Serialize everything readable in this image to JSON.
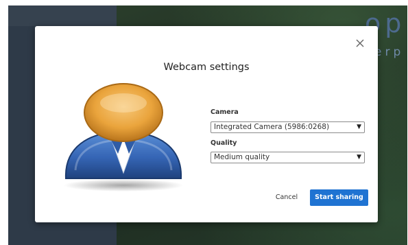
{
  "background": {
    "logo_text": "op",
    "tagline_text": "erp"
  },
  "dialog": {
    "title": "Webcam settings",
    "close_icon": "close-icon",
    "avatar_icon": "user-avatar-icon",
    "camera": {
      "label": "Camera",
      "selected": "Integrated Camera (5986:0268)"
    },
    "quality": {
      "label": "Quality",
      "selected": "Medium quality"
    },
    "buttons": {
      "cancel": "Cancel",
      "start": "Start sharing"
    }
  },
  "colors": {
    "primary_button": "#1f73d2",
    "avatar_head": "#e8a23a",
    "avatar_body": "#3a6fc0"
  }
}
